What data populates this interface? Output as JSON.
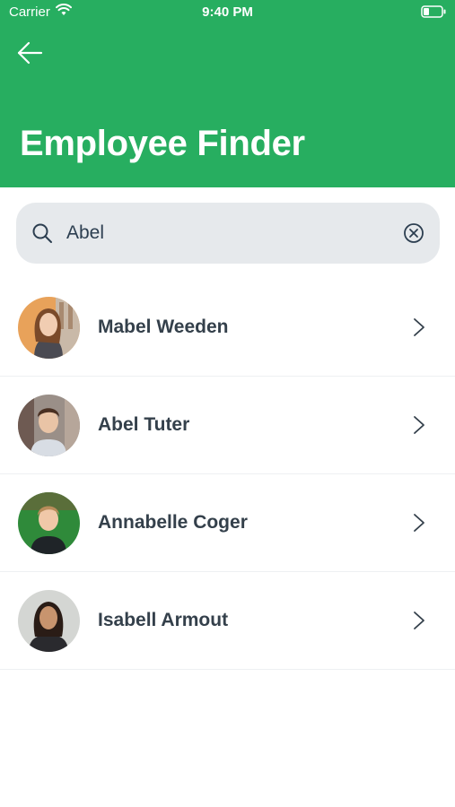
{
  "status_bar": {
    "carrier": "Carrier",
    "time": "9:40 PM",
    "wifi_icon": "wifi-icon",
    "battery_icon": "battery-icon"
  },
  "header": {
    "back_icon": "arrow-left-icon",
    "title": "Employee Finder",
    "background_color": "#27ae60"
  },
  "search": {
    "value": "Abel",
    "icon": "search-icon",
    "clear_icon": "clear-circle-icon"
  },
  "employees": [
    {
      "name": "Mabel Weeden",
      "avatar_icon": "avatar-photo"
    },
    {
      "name": "Abel Tuter",
      "avatar_icon": "avatar-photo"
    },
    {
      "name": "Annabelle Coger",
      "avatar_icon": "avatar-photo"
    },
    {
      "name": "Isabell Armout",
      "avatar_icon": "avatar-photo"
    }
  ],
  "colors": {
    "accent": "#27ae60",
    "search_background": "#e6e9ec",
    "name_text": "#34404b"
  }
}
